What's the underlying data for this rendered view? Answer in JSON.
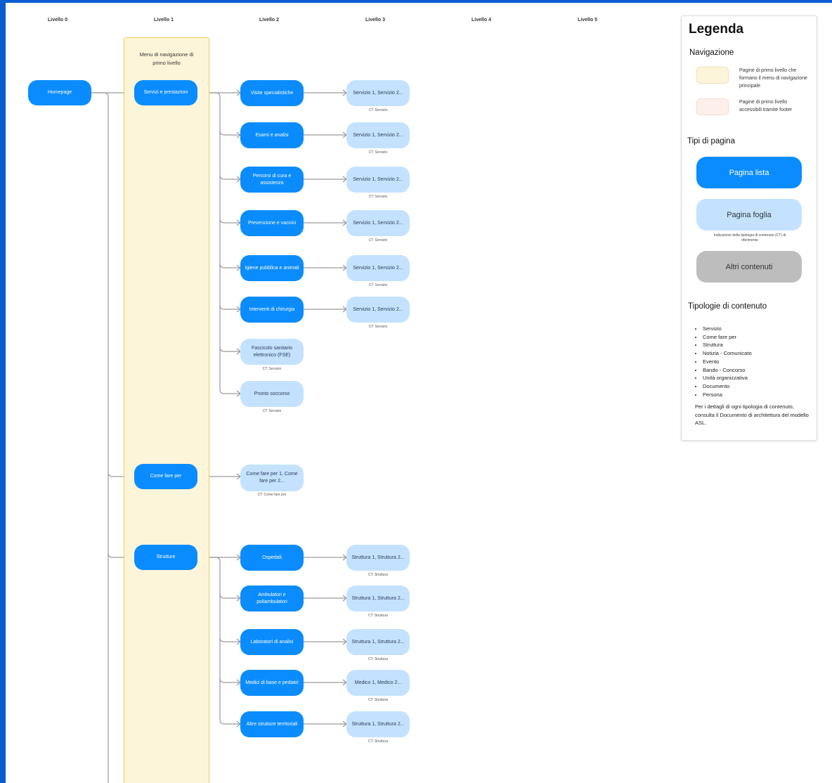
{
  "levels": [
    "Livello 0",
    "Livello 1",
    "Livello 2",
    "Livello 3",
    "Livello 4",
    "Livello 5"
  ],
  "menu_column_title": "Menu di navigazione di primo livello",
  "homepage": "Homepage",
  "level1": {
    "servizi": "Servizi e prestazioni",
    "come_fare": "Come fare per",
    "strutture": "Strutture"
  },
  "servizi_children": [
    {
      "label": "Visite specialistiche",
      "type": "list"
    },
    {
      "label": "Esami e analisi",
      "type": "list"
    },
    {
      "label": "Percorsi di cura e assistenza",
      "type": "list"
    },
    {
      "label": "Prevenzione e vaccini",
      "type": "list"
    },
    {
      "label": "Igiene pubblica e animali",
      "type": "list"
    },
    {
      "label": "Interventi di chirurgia",
      "type": "list"
    },
    {
      "label": "Fascicolo sanitario elettronico (FSE)",
      "type": "leaf",
      "ct": "CT: Servizio"
    },
    {
      "label": "Pronto soccorso",
      "type": "leaf",
      "ct": "CT: Servizio"
    }
  ],
  "servizi_leaves": [
    {
      "label": "Servizio 1, Servizio 2...",
      "ct": "CT: Servizio"
    },
    {
      "label": "Servizio 1, Servizio 2...",
      "ct": "CT: Servizio"
    },
    {
      "label": "Servizio 1, Servizio 2...",
      "ct": "CT: Servizio"
    },
    {
      "label": "Servizio 1, Servizio 2...",
      "ct": "CT: Servizio"
    },
    {
      "label": "Servizio 1, Servizio 2...",
      "ct": "CT: Servizio"
    },
    {
      "label": "Servizio 1, Servizio 2...",
      "ct": "CT: Servizio"
    }
  ],
  "come_fare_leaf": {
    "label": "Come fare per 1, Come fare per 2...",
    "ct": "CT: Come fare per"
  },
  "strutture_children": [
    {
      "label": "Ospedali"
    },
    {
      "label": "Ambulatori e poliambulatori"
    },
    {
      "label": "Laboratori di analisi"
    },
    {
      "label": "Medici di base e pediatri"
    },
    {
      "label": "Altre strutture territoriali"
    }
  ],
  "strutture_leaves": [
    {
      "label": "Struttura 1, Struttura 2...",
      "ct": "CT: Struttura"
    },
    {
      "label": "Struttura 1, Struttura 2...",
      "ct": "CT: Struttura"
    },
    {
      "label": "Struttura 1, Struttura 2...",
      "ct": "CT: Struttura"
    },
    {
      "label": "Medico 1, Medico 2...",
      "ct": "CT: Struttura"
    },
    {
      "label": "Struttura 1, Struttura 2...",
      "ct": "CT: Struttura"
    }
  ],
  "legend": {
    "title": "Legenda",
    "navigazione_heading": "Navigazione",
    "nav_primary_text": "Pagine di primo livello che formano il menu di navigazione principale",
    "nav_footer_text": "Pagine di primo livello accessibili tramite footer",
    "tipi_heading": "Tipi di pagina",
    "pagina_lista": "Pagina lista",
    "pagina_foglia": "Pagina foglia",
    "foglia_note": "Indicazione della tipologia di contenuto (CT) di riferimento",
    "altri_contenuti": "Altri contenuti",
    "tipologie_heading": "Tipologie di contenuto",
    "tipologie": [
      "Servizio",
      "Come fare per",
      "Struttura",
      "Notizia - Comunicato",
      "Evento",
      "Bando - Concorso",
      "Unità organizzativa",
      "Documento",
      "Persona"
    ],
    "footer_text": "Per i dettagli di ogni tipologia di contenuto, consulta il Documento di architettura del modello ASL."
  },
  "colors": {
    "page_list": "#0a8cff",
    "page_leaf": "#c4e2ff",
    "menu_primary": "#fdf5d9",
    "menu_footer": "#fdf0ea",
    "other_content": "#bdbdbd",
    "frame": "#0a5bd0"
  }
}
